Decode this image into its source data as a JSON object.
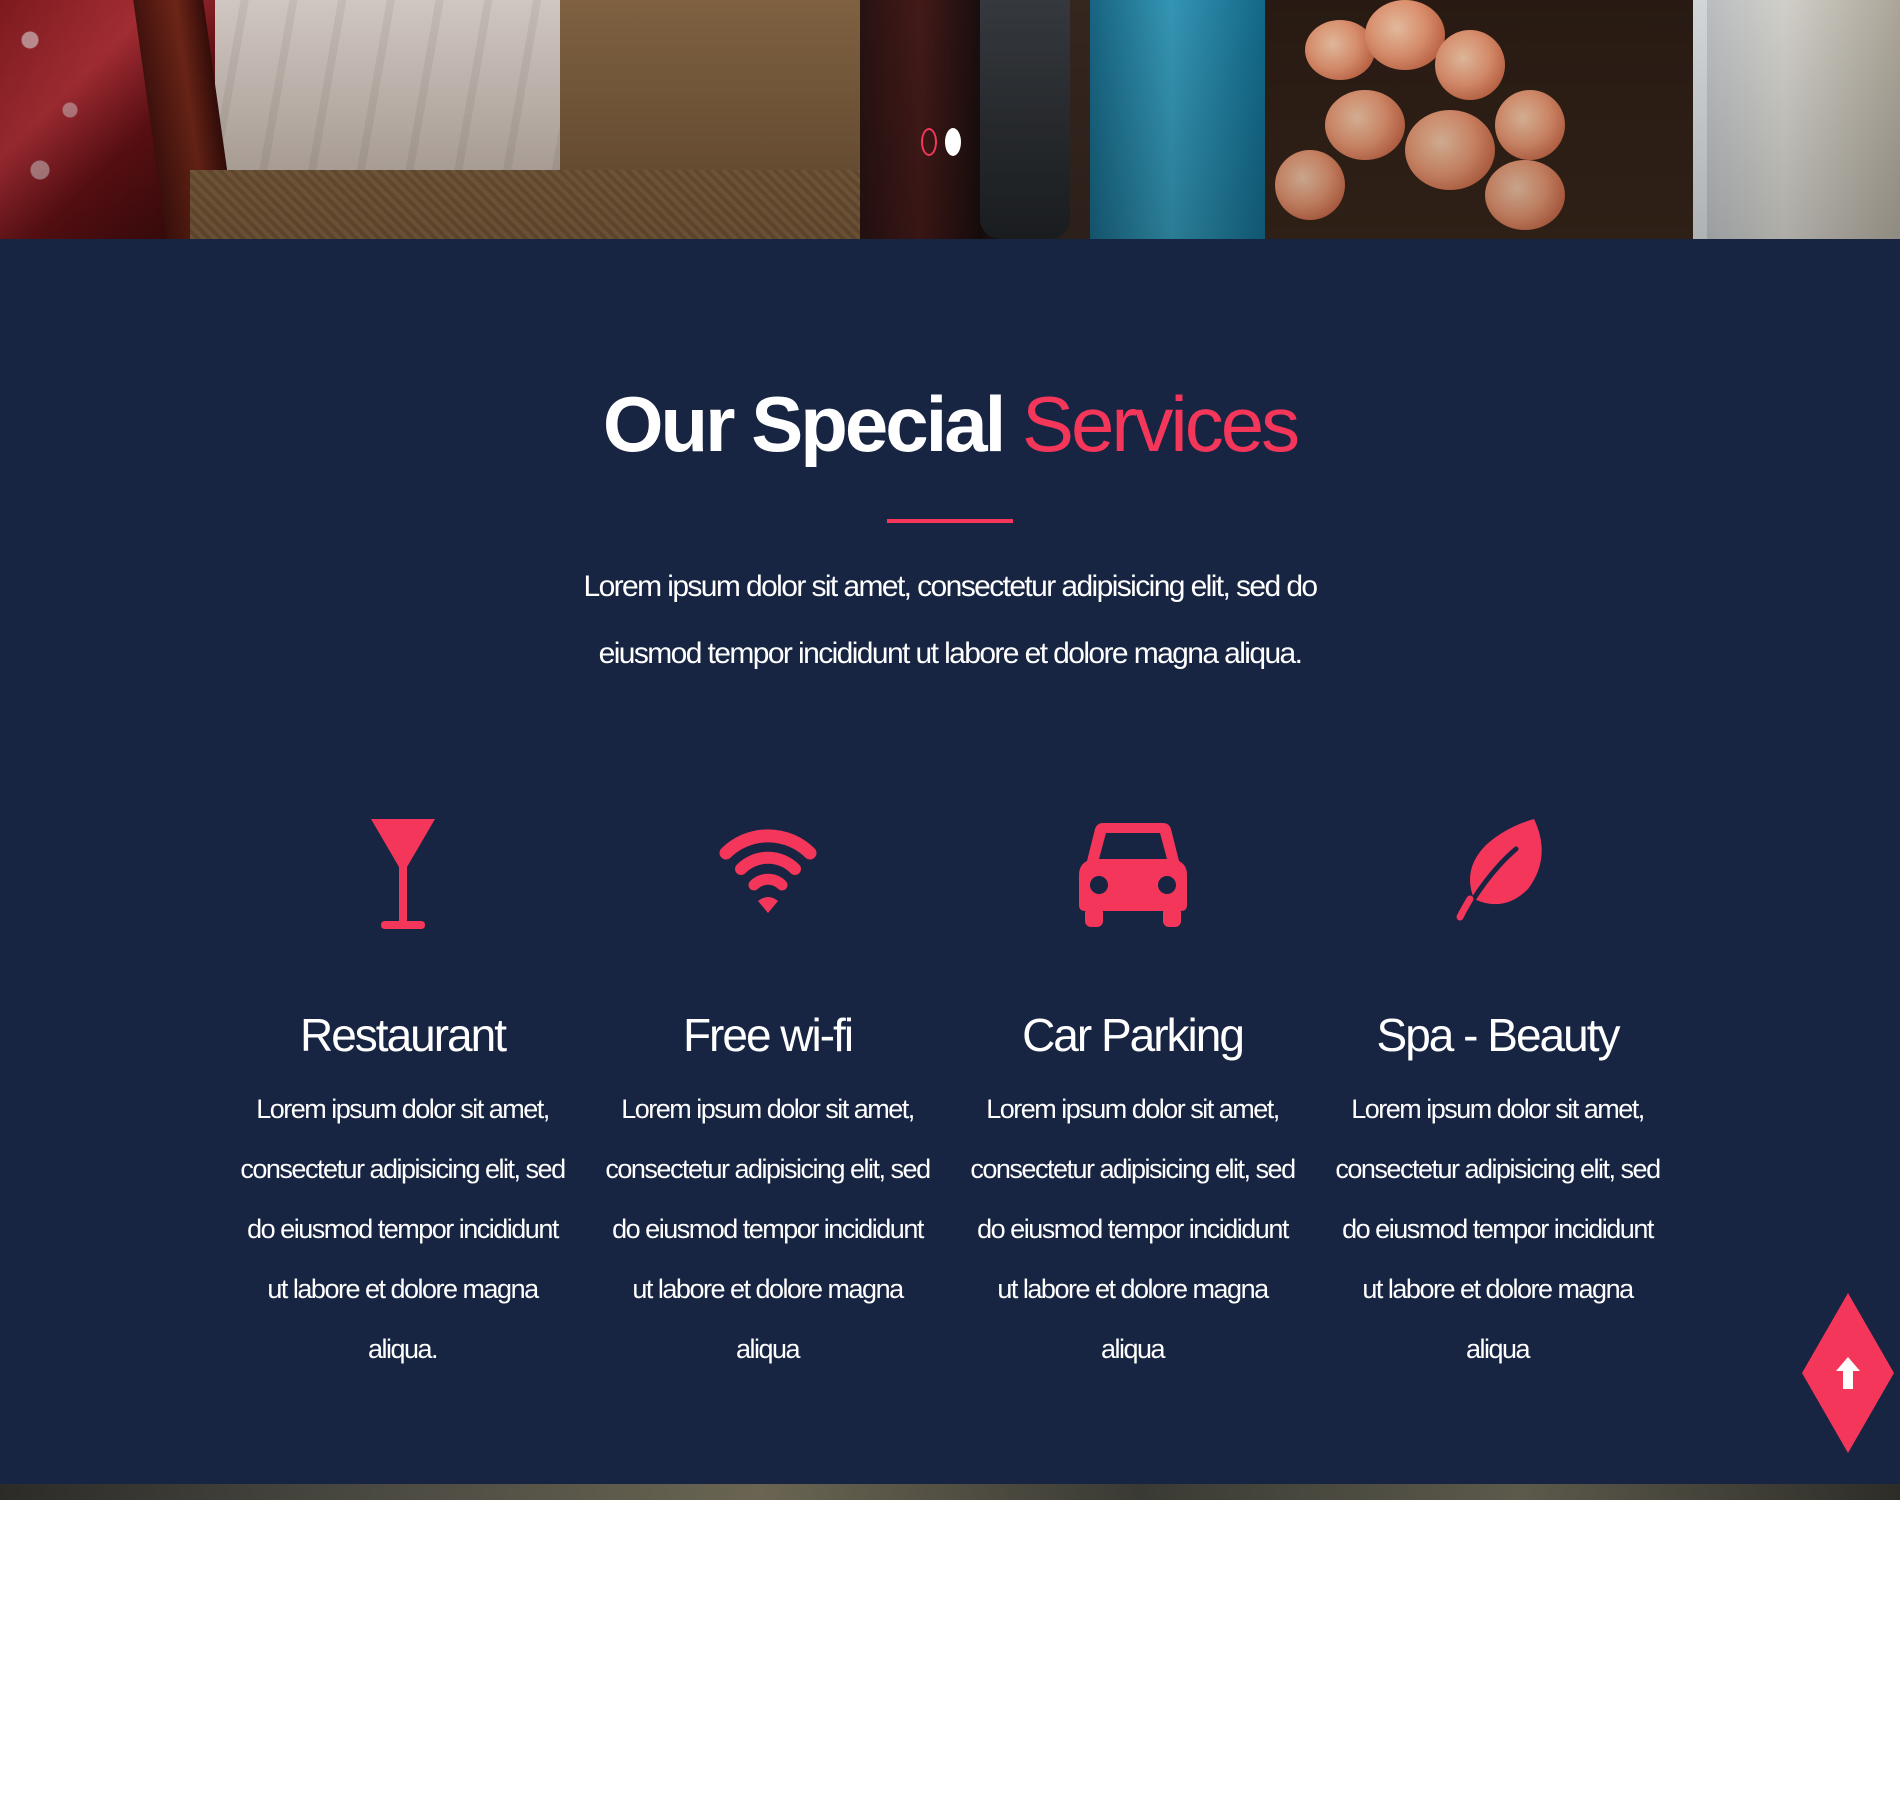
{
  "slider": {
    "dots": [
      {
        "state": "inactive"
      },
      {
        "state": "active"
      }
    ]
  },
  "services": {
    "title_main": "Our Special",
    "title_accent": "Services",
    "intro": "Lorem ipsum dolor sit amet, consectetur adipisicing elit, sed do eiusmod tempor incididunt ut labore et dolore magna aliqua.",
    "items": [
      {
        "icon": "cocktail-glass-icon",
        "title": "Restaurant",
        "text": "Lorem ipsum dolor sit amet, consectetur adipisicing elit, sed do eiusmod tempor incididunt ut labore et dolore magna aliqua."
      },
      {
        "icon": "wifi-icon",
        "title": "Free wi-fi",
        "text": "Lorem ipsum dolor sit amet, consectetur adipisicing elit, sed do eiusmod tempor incididunt ut labore et dolore magna aliqua"
      },
      {
        "icon": "car-icon",
        "title": "Car Parking",
        "text": "Lorem ipsum dolor sit amet, consectetur adipisicing elit, sed do eiusmod tempor incididunt ut labore et dolore magna aliqua"
      },
      {
        "icon": "leaf-icon",
        "title": "Spa - Beauty",
        "text": "Lorem ipsum dolor sit amet, consectetur adipisicing elit, sed do eiusmod tempor incididunt ut labore et dolore magna aliqua"
      }
    ]
  },
  "scroll_top": {
    "icon": "arrow-up-icon"
  },
  "colors": {
    "background": "#172442",
    "accent": "#f4365a",
    "text": "#ffffff"
  }
}
